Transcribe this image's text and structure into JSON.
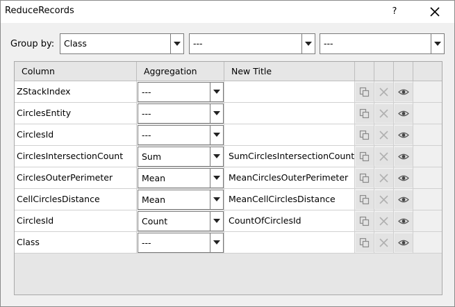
{
  "window": {
    "title": "ReduceRecords",
    "help_label": "?"
  },
  "group_by": {
    "label": "Group by:",
    "combos": [
      "Class",
      "---",
      "---"
    ]
  },
  "table": {
    "headers": {
      "column": "Column",
      "aggregation": "Aggregation",
      "new_title": "New Title"
    },
    "rows": [
      {
        "column": "ZStackIndex",
        "aggregation": "---",
        "new_title": ""
      },
      {
        "column": "CirclesEntity",
        "aggregation": "---",
        "new_title": ""
      },
      {
        "column": "CirclesId",
        "aggregation": "---",
        "new_title": ""
      },
      {
        "column": "CirclesIntersectionCount",
        "aggregation": "Sum",
        "new_title": "SumCirclesIntersectionCount"
      },
      {
        "column": "CirclesOuterPerimeter",
        "aggregation": "Mean",
        "new_title": "MeanCirclesOuterPerimeter"
      },
      {
        "column": "CellCirclesDistance",
        "aggregation": "Mean",
        "new_title": "MeanCellCirclesDistance"
      },
      {
        "column": "CirclesId",
        "aggregation": "Count",
        "new_title": "CountOfCirclesId"
      },
      {
        "column": "Class",
        "aggregation": "---",
        "new_title": ""
      }
    ],
    "row_icons": [
      "copy-icon",
      "delete-icon",
      "eye-icon"
    ]
  }
}
